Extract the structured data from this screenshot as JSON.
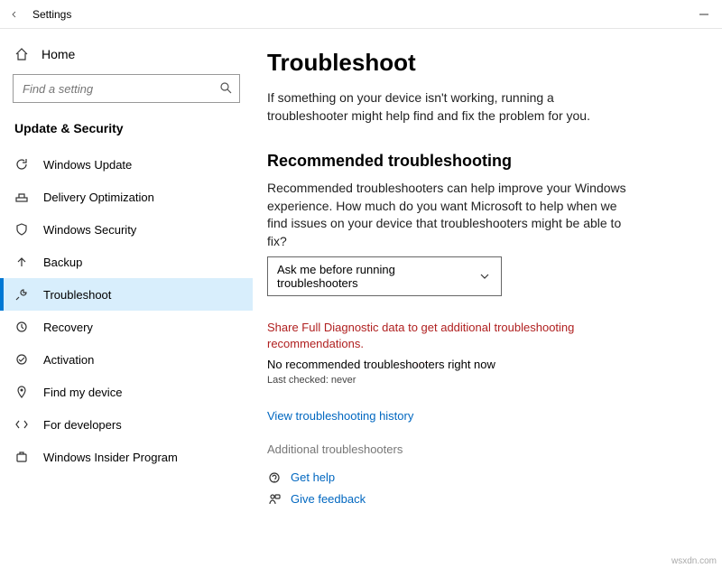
{
  "titlebar": {
    "title": "Settings"
  },
  "sidebar": {
    "home": "Home",
    "searchPlaceholder": "Find a setting",
    "section": "Update & Security",
    "items": [
      {
        "label": "Windows Update"
      },
      {
        "label": "Delivery Optimization"
      },
      {
        "label": "Windows Security"
      },
      {
        "label": "Backup"
      },
      {
        "label": "Troubleshoot"
      },
      {
        "label": "Recovery"
      },
      {
        "label": "Activation"
      },
      {
        "label": "Find my device"
      },
      {
        "label": "For developers"
      },
      {
        "label": "Windows Insider Program"
      }
    ]
  },
  "main": {
    "title": "Troubleshoot",
    "intro": "If something on your device isn't working, running a troubleshooter might help find and fix the problem for you.",
    "recommended": {
      "heading": "Recommended troubleshooting",
      "desc": "Recommended troubleshooters can help improve your Windows experience. How much do you want Microsoft to help when we find issues on your device that troubleshooters might be able to fix?",
      "dropdown": "Ask me before running troubleshooters",
      "warn": "Share Full Diagnostic data to get additional troubleshooting recommendations.",
      "status": "No recommended troubleshooters right now",
      "lastChecked": "Last checked: never"
    },
    "historyLink": "View troubleshooting history",
    "additional": "Additional troubleshooters",
    "help": {
      "getHelp": "Get help",
      "feedback": "Give feedback"
    }
  },
  "watermark": "wsxdn.com"
}
